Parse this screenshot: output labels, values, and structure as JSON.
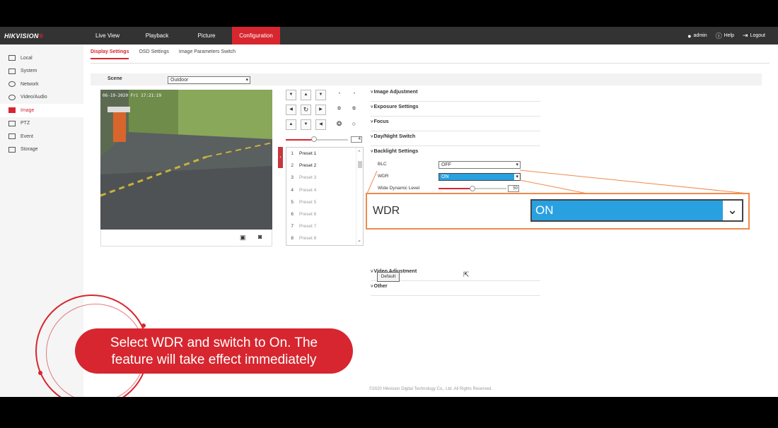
{
  "brand": {
    "name": "HIKVISION",
    "mark": "®"
  },
  "nav": {
    "tabs": [
      {
        "label": "Live View"
      },
      {
        "label": "Playback"
      },
      {
        "label": "Picture"
      },
      {
        "label": "Configuration",
        "active": true
      }
    ],
    "user": "admin",
    "help": "Help",
    "logout": "Logout"
  },
  "sidebar": {
    "items": [
      {
        "label": "Local",
        "icon": "monitor-icon"
      },
      {
        "label": "System",
        "icon": "system-icon"
      },
      {
        "label": "Network",
        "icon": "globe-icon"
      },
      {
        "label": "Video/Audio",
        "icon": "video-audio-icon"
      },
      {
        "label": "Image",
        "icon": "image-icon",
        "active": true
      },
      {
        "label": "PTZ",
        "icon": "ptz-icon"
      },
      {
        "label": "Event",
        "icon": "calendar-icon"
      },
      {
        "label": "Storage",
        "icon": "storage-icon"
      }
    ]
  },
  "subtabs": [
    {
      "label": "Display Settings",
      "active": true
    },
    {
      "label": "OSD Settings"
    },
    {
      "label": "Image Parameters Switch"
    }
  ],
  "scene": {
    "label": "Scene",
    "value": "Outdoor"
  },
  "video": {
    "osd_text": "06-19-2020 Fri 17:21:19"
  },
  "ptz": {
    "speed_value": "4",
    "speed_level": 0.45
  },
  "presets": [
    {
      "num": "1",
      "label": "Preset 1",
      "set": true
    },
    {
      "num": "2",
      "label": "Preset 2",
      "set": true
    },
    {
      "num": "3",
      "label": "Preset 3"
    },
    {
      "num": "4",
      "label": "Preset 4"
    },
    {
      "num": "5",
      "label": "Preset 5"
    },
    {
      "num": "6",
      "label": "Preset 6"
    },
    {
      "num": "7",
      "label": "Preset 7"
    },
    {
      "num": "8",
      "label": "Preset 8"
    }
  ],
  "settings": {
    "sections": {
      "image_adjustment": "Image Adjustment",
      "exposure": "Exposure Settings",
      "focus": "Focus",
      "day_night": "Day/Night Switch",
      "backlight": "Backlight Settings",
      "video_adjustment": "Video Adjustment",
      "other": "Other"
    },
    "blc": {
      "label": "BLC",
      "value": "OFF"
    },
    "wdr": {
      "label": "WDR",
      "value": "ON"
    },
    "wdl": {
      "label": "Wide Dynamic Level",
      "value": "50",
      "level": 0.5
    },
    "default_button": "Default"
  },
  "callout": {
    "label": "WDR",
    "value": "ON"
  },
  "footer": {
    "copyright": "©2020 Hikvision Digital Technology Co., Ltd. All Rights Reserved."
  },
  "caption": {
    "line1": "Select WDR and switch to On. The",
    "line2": "feature will take effect immediately"
  },
  "colors": {
    "accent": "#d7262f",
    "highlight": "#29a0e0",
    "callout_border": "#f08a4b"
  }
}
